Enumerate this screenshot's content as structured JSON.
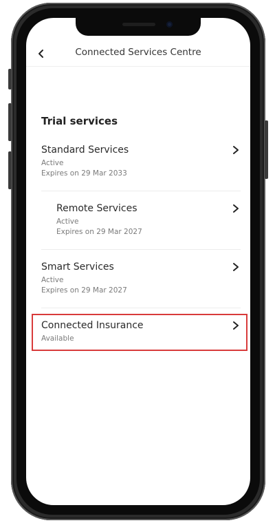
{
  "header": {
    "title": "Connected Services Centre",
    "back_icon": "chevron-left-icon"
  },
  "section": {
    "title": "Trial services"
  },
  "services": [
    {
      "name": "Standard Services",
      "status": "Active",
      "expiry": "Expires on 29 Mar 2033"
    },
    {
      "name": "Remote Services",
      "status": "Active",
      "expiry": "Expires on 29 Mar 2027"
    },
    {
      "name": "Smart Services",
      "status": "Active",
      "expiry": "Expires on 29 Mar 2027"
    },
    {
      "name": "Connected Insurance",
      "status": "Available"
    }
  ],
  "highlight": {
    "color": "#d83a3a",
    "target": "Connected Insurance"
  },
  "colors": {
    "text_primary": "#2a2a2a",
    "text_secondary": "#7a7a7a",
    "device_frame": "#2b2b2b"
  }
}
